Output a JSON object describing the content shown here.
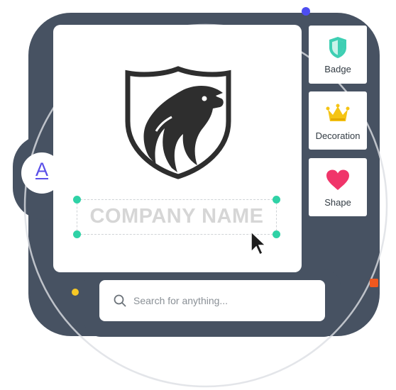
{
  "canvas": {
    "company_name": "COMPANY NAME"
  },
  "tools": [
    {
      "label": "Badge",
      "icon": "badge-shield-icon",
      "color": "#3ecfb3"
    },
    {
      "label": "Decoration",
      "icon": "crown-icon",
      "color": "#f5c414"
    },
    {
      "label": "Shape",
      "icon": "heart-icon",
      "color": "#f0356a"
    }
  ],
  "text_tool": {
    "glyph": "A",
    "color": "#5a4fe8"
  },
  "search": {
    "placeholder": "Search for anything..."
  },
  "colors": {
    "backdrop": "#475262",
    "accent_teal": "#2fd2a6",
    "dot_blue": "#4d4df0",
    "dot_yellow": "#f7c825",
    "dot_orange": "#f0581e"
  }
}
